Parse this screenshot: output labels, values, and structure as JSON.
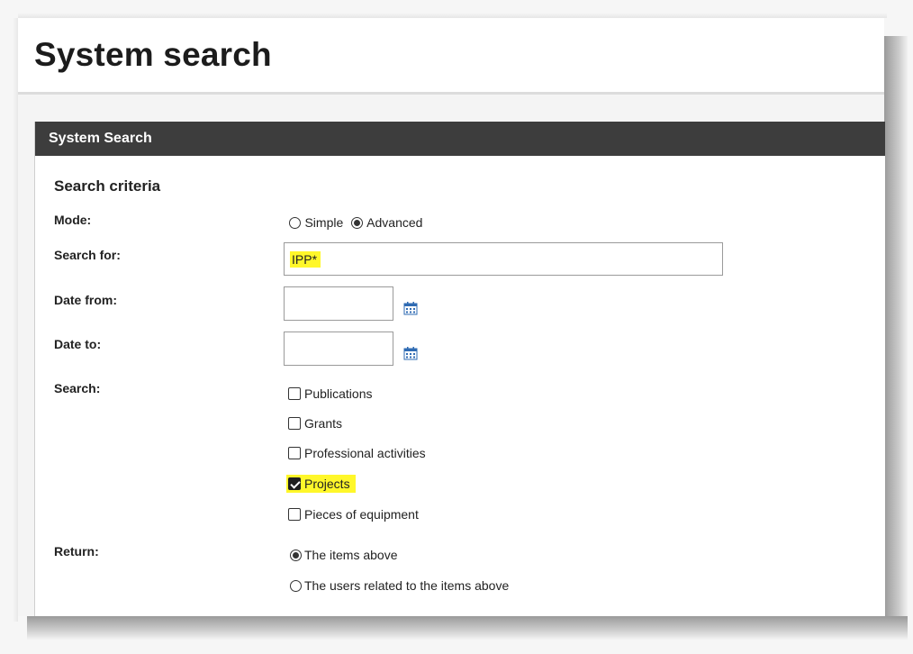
{
  "page": {
    "title": "System search"
  },
  "panel": {
    "header": "System Search"
  },
  "criteria": {
    "section_title": "Search criteria",
    "mode": {
      "label": "Mode:",
      "options": [
        "Simple",
        "Advanced"
      ],
      "selected": "Advanced"
    },
    "search_for": {
      "label": "Search for:",
      "value": "IPP*"
    },
    "date_from": {
      "label": "Date from:",
      "value": ""
    },
    "date_to": {
      "label": "Date to:",
      "value": ""
    },
    "search": {
      "label": "Search:",
      "options": [
        {
          "label": "Publications",
          "checked": false
        },
        {
          "label": "Grants",
          "checked": false
        },
        {
          "label": "Professional activities",
          "checked": false
        },
        {
          "label": "Projects",
          "checked": true
        },
        {
          "label": "Pieces of equipment",
          "checked": false
        }
      ]
    },
    "return": {
      "label": "Return:",
      "options": [
        "The items above",
        "The users related to the items above"
      ],
      "selected": "The items above"
    }
  },
  "icons": {
    "calendar": "calendar-icon"
  },
  "colors": {
    "highlight": "#fff72a",
    "panel_header_bg": "#3d3d3d",
    "calendar_icon": "#2f6bb3"
  }
}
